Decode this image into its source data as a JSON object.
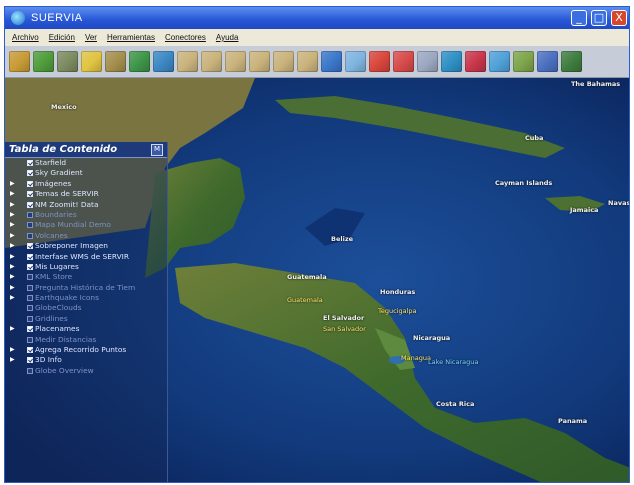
{
  "window": {
    "title": "SUERVIA",
    "buttons": {
      "minimize": "_",
      "maximize": "□",
      "close": "X"
    }
  },
  "menu": [
    "Archivo",
    "Edición",
    "Ver",
    "Herramientas",
    "Conectores",
    "Ayuda"
  ],
  "toolbar": {
    "tools": [
      {
        "icon": "satellite-image-icon",
        "color": "#c79a35"
      },
      {
        "icon": "terrain-icon",
        "color": "#4f9b3a"
      },
      {
        "icon": "xyz-coordinates-icon",
        "color": "#7c8a60"
      },
      {
        "icon": "sun-icon",
        "color": "#e0c341"
      },
      {
        "icon": "landsat-icon",
        "color": "#a38e4c"
      },
      {
        "icon": "vegetation-icon",
        "color": "#3d9448"
      },
      {
        "icon": "blue-marble-icon",
        "color": "#3b86c2"
      },
      {
        "icon": "layer-folder-icon",
        "color": "#c9b37c"
      },
      {
        "icon": "layer-folder-icon",
        "color": "#c9b37c"
      },
      {
        "icon": "layer-folder-icon",
        "color": "#c9b37c"
      },
      {
        "icon": "layer-folder-icon",
        "color": "#c9b37c"
      },
      {
        "icon": "layer-folder-icon",
        "color": "#c9b37c"
      },
      {
        "icon": "layer-folder-icon",
        "color": "#c9b37c"
      },
      {
        "icon": "globe-icon",
        "color": "#3a76c9"
      },
      {
        "icon": "cloud-icon",
        "color": "#7fb3e0"
      },
      {
        "icon": "flag-icon",
        "color": "#d8453b"
      },
      {
        "icon": "lifesaver-icon",
        "color": "#d64a4a"
      },
      {
        "icon": "map-pin-icon",
        "color": "#9aa7c0"
      },
      {
        "icon": "radar-icon",
        "color": "#2e8fc4"
      },
      {
        "icon": "weather-icon",
        "color": "#c8354a"
      },
      {
        "icon": "water-icon",
        "color": "#4fa0d8"
      },
      {
        "icon": "landscape-icon",
        "color": "#7da44b"
      },
      {
        "icon": "chart-icon",
        "color": "#4b6fc0"
      },
      {
        "icon": "globe-settings-icon",
        "color": "#3e7c3e"
      }
    ]
  },
  "toc": {
    "title": "Tabla de Contenido",
    "pin_label": "M",
    "layers": [
      {
        "label": "Starfield",
        "expand": false,
        "checked": true,
        "dim": false
      },
      {
        "label": "Sky Gradient",
        "expand": false,
        "checked": true,
        "dim": false
      },
      {
        "label": "Imágenes",
        "expand": true,
        "checked": true,
        "dim": false
      },
      {
        "label": "Temas de SERVIR",
        "expand": true,
        "checked": true,
        "dim": false
      },
      {
        "label": "NM Zoomit! Data",
        "expand": true,
        "checked": true,
        "dim": false
      },
      {
        "label": "Boundaries",
        "expand": true,
        "checked": false,
        "dim": true
      },
      {
        "label": "Mapa Mundial Demo",
        "expand": true,
        "checked": false,
        "dim": true
      },
      {
        "label": "Volcanes",
        "expand": true,
        "checked": false,
        "dim": true
      },
      {
        "label": "Sobreponer Imagen",
        "expand": true,
        "checked": true,
        "dim": false
      },
      {
        "label": "Interfase WMS de SERVIR",
        "expand": true,
        "checked": true,
        "dim": false
      },
      {
        "label": "Mis Lugares",
        "expand": true,
        "checked": true,
        "dim": false
      },
      {
        "label": "KML Store",
        "expand": true,
        "checked": false,
        "dim": true
      },
      {
        "label": "Pregunta Histórica de Tiem",
        "expand": true,
        "checked": false,
        "dim": true
      },
      {
        "label": "Earthquake Icons",
        "expand": true,
        "checked": false,
        "dim": true
      },
      {
        "label": "GlobeClouds",
        "expand": false,
        "checked": false,
        "dim": true
      },
      {
        "label": "Gridlines",
        "expand": false,
        "checked": false,
        "dim": true
      },
      {
        "label": "Placenames",
        "expand": true,
        "checked": true,
        "dim": false
      },
      {
        "label": "Medir Distancias",
        "expand": false,
        "checked": false,
        "dim": true
      },
      {
        "label": "Agrega Recorrido Puntos",
        "expand": true,
        "checked": true,
        "dim": false
      },
      {
        "label": "3D Info",
        "expand": true,
        "checked": true,
        "dim": false
      },
      {
        "label": "Globe Overview",
        "expand": false,
        "checked": false,
        "dim": true
      }
    ]
  },
  "map": {
    "places": [
      {
        "name": "The Bahamas",
        "style": "white"
      },
      {
        "name": "Mexico",
        "style": "white"
      },
      {
        "name": "Cuba",
        "style": "white"
      },
      {
        "name": "Cayman Islands",
        "style": "white"
      },
      {
        "name": "Jamaica",
        "style": "white"
      },
      {
        "name": "Navassa",
        "style": "white"
      },
      {
        "name": "Belize",
        "style": "white"
      },
      {
        "name": "Guatemala",
        "style": "white"
      },
      {
        "name": "Honduras",
        "style": "white"
      },
      {
        "name": "Tegucigalpa",
        "style": "yellow"
      },
      {
        "name": "Guatemala",
        "style": "yellow"
      },
      {
        "name": "El Salvador",
        "style": "white"
      },
      {
        "name": "San Salvador",
        "style": "yellow"
      },
      {
        "name": "Nicaragua",
        "style": "white"
      },
      {
        "name": "Managua",
        "style": "yellow"
      },
      {
        "name": "Lake Nicaragua",
        "style": "cyan"
      },
      {
        "name": "Costa Rica",
        "style": "white"
      },
      {
        "name": "Panama",
        "style": "white"
      }
    ]
  }
}
